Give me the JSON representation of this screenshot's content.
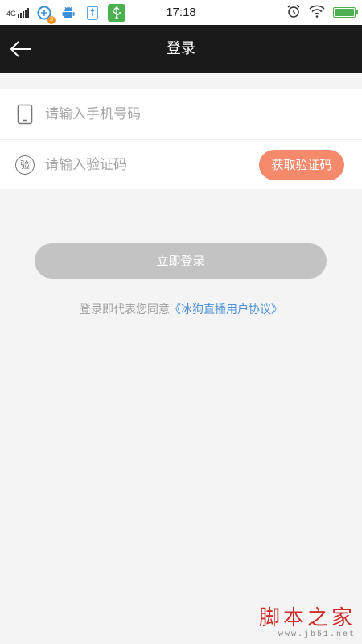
{
  "status_bar": {
    "network": "4G",
    "notification_badge": "3",
    "time": "17:18",
    "battery_level_percent": 100,
    "accent_usb": "#4caf50"
  },
  "nav": {
    "title": "登录"
  },
  "form": {
    "phone": {
      "icon": "phone-icon",
      "placeholder": "请输入手机号码",
      "value": ""
    },
    "code": {
      "icon": "verify-code-icon",
      "icon_glyph": "验",
      "placeholder": "请输入验证码",
      "value": "",
      "button_label": "获取验证码"
    }
  },
  "login_button": {
    "label": "立即登录"
  },
  "agreement": {
    "prefix": "登录即代表您同意",
    "link": "《冰狗直播用户协议》"
  },
  "watermark": {
    "main": "脚本之家",
    "url": "www.jb51.net"
  },
  "colors": {
    "nav_bg": "#1a1a1a",
    "code_button": "#f4896b",
    "login_button": "#c3c3c3",
    "link": "#4a90d9"
  }
}
